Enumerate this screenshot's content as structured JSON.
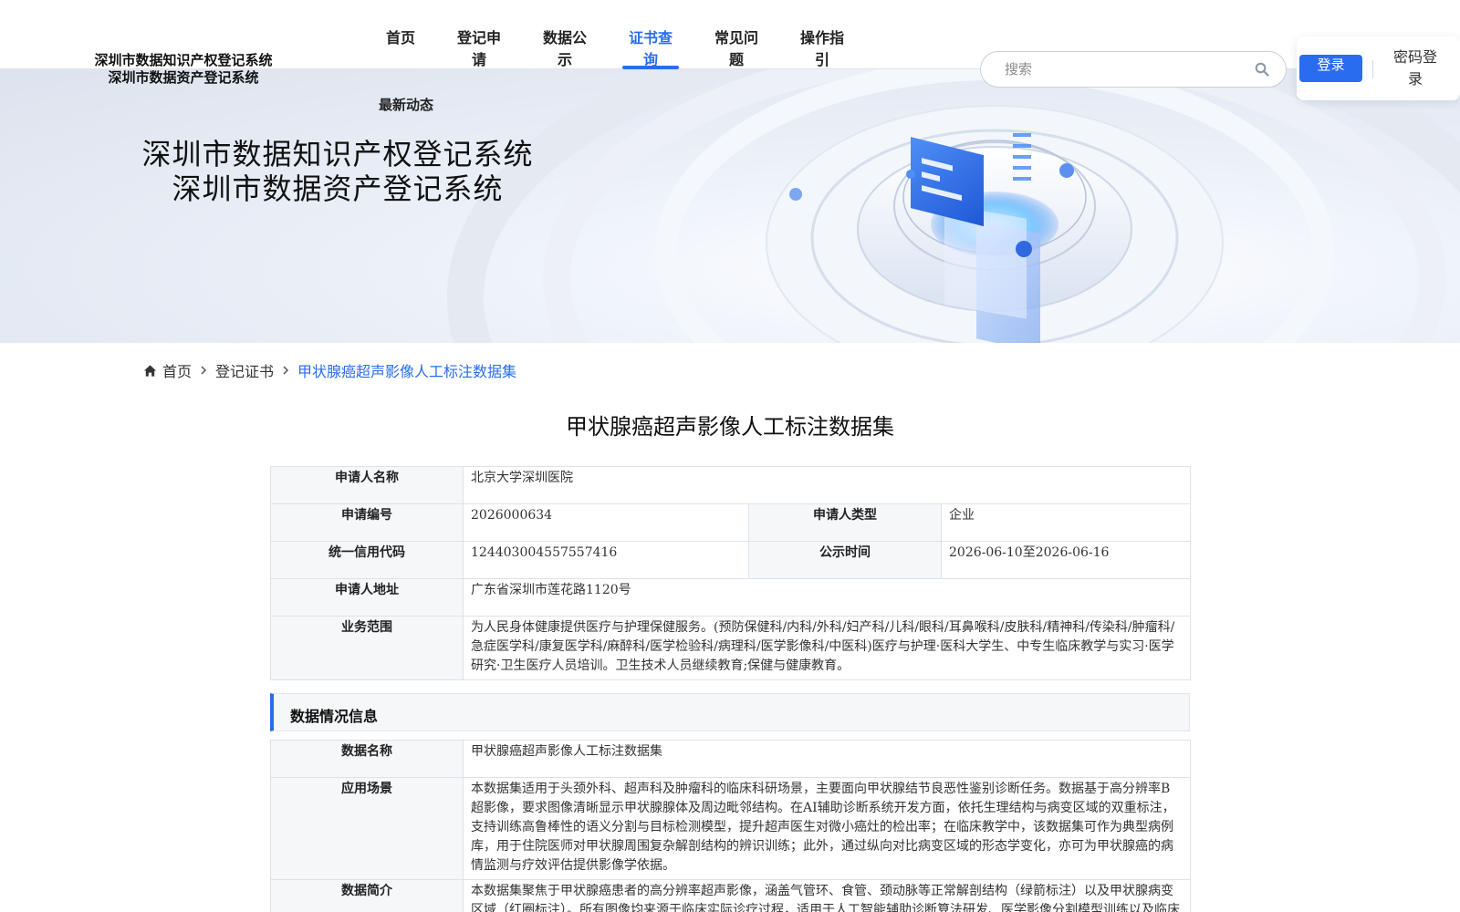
{
  "header": {
    "logo_line1": "深圳市数据知识产权登记系统",
    "logo_line2": "深圳市数据资产登记系统",
    "nav": [
      {
        "label": "首页",
        "active": false
      },
      {
        "label": "登记申请",
        "active": false
      },
      {
        "label": "数据公示",
        "active": false
      },
      {
        "label": "证书查询",
        "active": true
      },
      {
        "label": "常见问题",
        "active": false
      },
      {
        "label": "操作指引",
        "active": false
      }
    ],
    "sub_nav_label": "最新动态",
    "search_placeholder": "搜索",
    "login_label": "登录",
    "password_login_label": "密码登录",
    "accent_color": "#2a6cf0"
  },
  "banner": {
    "title_line1": "深圳市数据知识产权登记系统",
    "title_line2": "深圳市数据资产登记系统"
  },
  "breadcrumb": {
    "items": [
      "首页",
      "登记证书",
      "甲状腺癌超声影像人工标注数据集"
    ]
  },
  "page_title": "甲状腺癌超声影像人工标注数据集",
  "applicant": {
    "name_label": "申请人名称",
    "name_value": "北京大学深圳医院",
    "number_label": "申请编号",
    "number_value": "2026000634",
    "type_label": "申请人类型",
    "type_value": "企业",
    "credit_code_label": "统一信用代码",
    "credit_code_value": "124403004557557416",
    "publicity_time_label": "公示时间",
    "publicity_time_value": "2026-06-10至2026-06-16",
    "address_label": "申请人地址",
    "address_value": "广东省深圳市莲花路1120号",
    "scope_label": "业务范围",
    "scope_value": "为人民身体健康提供医疗与护理保健服务。(预防保健科/内科/外科/妇产科/儿科/眼科/耳鼻喉科/皮肤科/精神科/传染科/肿瘤科/急症医学科/康复医学科/麻醉科/医学检验科/病理科/医学影像科/中医科)医疗与护理·医科大学生、中专生临床教学与实习·医学研究·卫生医疗人员培训。卫生技术人员继续教育;保健与健康教育。"
  },
  "data_section": {
    "heading": "数据情况信息",
    "data_name_label": "数据名称",
    "data_name_value": "甲状腺癌超声影像人工标注数据集",
    "scenario_label": "应用场景",
    "scenario_value": "本数据集适用于头颈外科、超声科及肿瘤科的临床科研场景，主要面向甲状腺结节良恶性鉴别诊断任务。数据基于高分辨率B超影像，要求图像清晰显示甲状腺腺体及周边毗邻结构。在AI辅助诊断系统开发方面，依托生理结构与病变区域的双重标注，支持训练高鲁棒性的语义分割与目标检测模型，提升超声医生对微小癌灶的检出率；在临床教学中，该数据集可作为典型病例库，用于住院医师对甲状腺周围复杂解剖结构的辨识训练；此外，通过纵向对比病变区域的形态学变化，亦可为甲状腺癌的病情监测与疗效评估提供影像学依据。",
    "intro_label": "数据简介",
    "intro_value": "本数据集聚焦于甲状腺癌患者的高分辨率超声影像，涵盖气管环、食管、颈动脉等正常解剖结构（绿箭标注）以及甲状腺病变区域（红圈标注）。所有图像均来源于临床实际诊疗过程，适用于人工智能辅助诊断算法研发、医学影像分割模型训练以及临床教"
  }
}
